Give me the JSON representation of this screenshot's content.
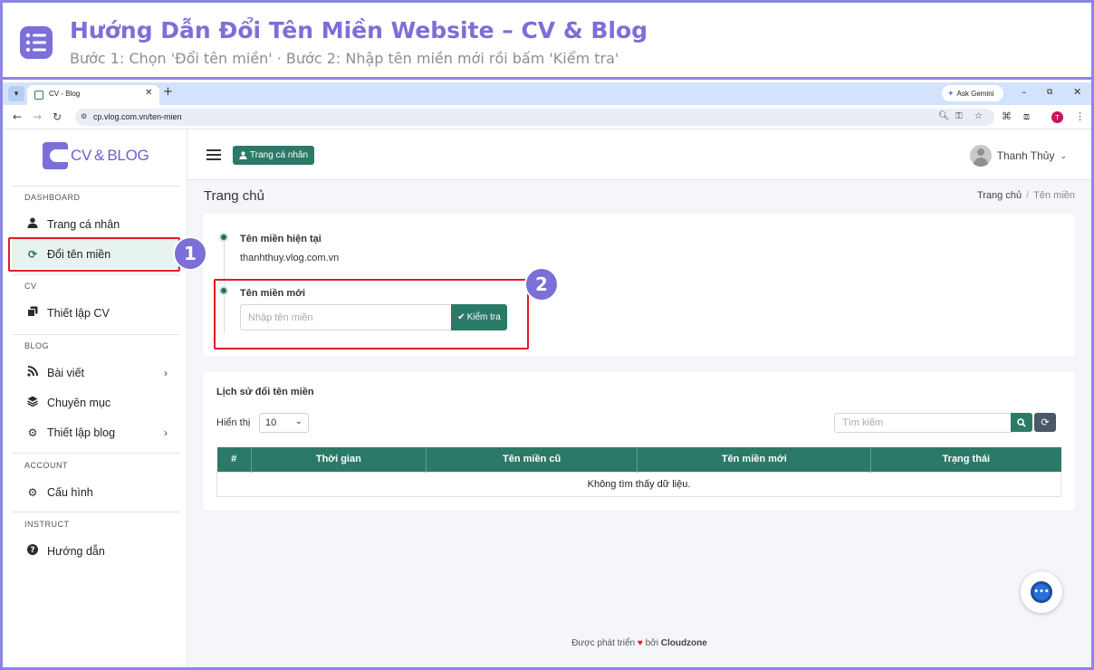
{
  "banner": {
    "title": "Hướng Dẫn Đổi Tên Miền Website – CV & Blog",
    "subtitle": "Bước 1: Chọn 'Đổi tên miền' · Bước 2: Nhập tên miền mới rồi bấm 'Kiểm tra'",
    "accent": "#7b6fd8"
  },
  "browser": {
    "tab_title": "CV - Blog",
    "url": "cp.vlog.com.vn/ten-mien",
    "gemini_label": "Ask Gemini",
    "profile_initial": "T"
  },
  "logo": {
    "text_cv": "CV",
    "text_amp": "&",
    "text_blog": "BLOG"
  },
  "sidebar": {
    "sections": [
      "DASHBOARD",
      "CV",
      "BLOG",
      "ACCOUNT",
      "INSTRUCT"
    ],
    "items": [
      {
        "label": "Trang cá nhân",
        "icon": "user-icon"
      },
      {
        "label": "Đổi tên miền",
        "icon": "sync-icon",
        "active": true
      },
      {
        "label": "Thiết lập CV",
        "icon": "copy-icon"
      },
      {
        "label": "Bài viết",
        "icon": "blog-icon"
      },
      {
        "label": "Chuyên mục",
        "icon": "layers-icon"
      },
      {
        "label": "Thiết lập blog",
        "icon": "cogs-icon"
      },
      {
        "label": "Cấu hình",
        "icon": "gear-icon"
      },
      {
        "label": "Hướng dẫn",
        "icon": "question-icon"
      }
    ]
  },
  "header": {
    "profile_button": "Trang cá nhân",
    "user_name": "Thanh Thủy"
  },
  "page": {
    "title": "Trang chủ",
    "breadcrumb": [
      "Trang chủ",
      "Tên miền"
    ]
  },
  "domain_card": {
    "current_label": "Tên miền hiện tại",
    "current_value": "thanhthuy.vlog.com.vn",
    "new_label": "Tên miền mới",
    "new_placeholder": "Nhập tên miền",
    "check_button": "Kiểm tra"
  },
  "markers": {
    "step1": "1",
    "step2": "2"
  },
  "history": {
    "title": "Lịch sử đổi tên miền",
    "show_label": "Hiển thị",
    "page_size": "10",
    "search_placeholder": "Tìm kiếm",
    "columns": [
      "#",
      "Thời gian",
      "Tên miền cũ",
      "Tên miền mới",
      "Trạng thái"
    ],
    "empty_text": "Không tìm thấy dữ liệu."
  },
  "footer": {
    "prefix": "Được phát triển",
    "middle": "bởi",
    "brand": "Cloudzone"
  },
  "colors": {
    "primary": "#2b7a67",
    "highlight": "#e01b24",
    "heart": "#e01b24"
  }
}
